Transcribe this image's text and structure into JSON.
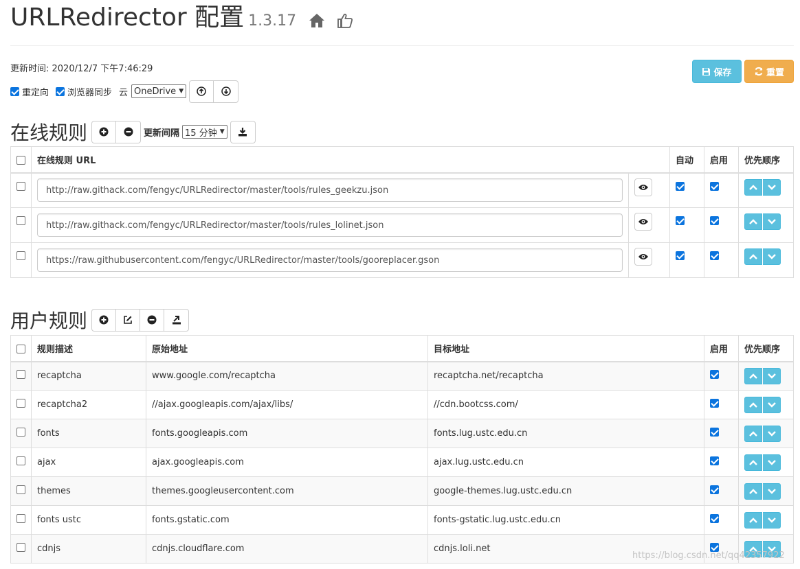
{
  "header": {
    "title": "URLRedirector 配置",
    "version": "1.3.17",
    "home_icon": "home-icon",
    "like_icon": "thumbs-up-icon"
  },
  "meta": {
    "updated_label": "更新时间: 2020/12/7 下午7:46:29"
  },
  "options": {
    "redirect": {
      "label": "重定向",
      "checked": true
    },
    "sync": {
      "label": "浏览器同步",
      "checked": true
    },
    "cloud_label": "云",
    "cloud_value": "OneDrive"
  },
  "actions": {
    "save_label": "保存",
    "reset_label": "重置"
  },
  "colors": {
    "info": "#5bc0de",
    "warning": "#f0ad4e",
    "check": "#0b74de"
  },
  "online": {
    "title": "在线规则",
    "interval_label": "更新间隔",
    "interval_value": "15 分钟",
    "columns": {
      "url": "在线规则 URL",
      "auto": "自动",
      "enabled": "启用",
      "priority": "优先顺序"
    },
    "rows": [
      {
        "url": "http://raw.githack.com/fengyc/URLRedirector/master/tools/rules_geekzu.json",
        "auto": true,
        "enabled": true
      },
      {
        "url": "http://raw.githack.com/fengyc/URLRedirector/master/tools/rules_lolinet.json",
        "auto": true,
        "enabled": true
      },
      {
        "url": "https://raw.githubusercontent.com/fengyc/URLRedirector/master/tools/gooreplacer.gson",
        "auto": true,
        "enabled": true
      }
    ]
  },
  "user": {
    "title": "用户规则",
    "columns": {
      "desc": "规则描述",
      "origin": "原始地址",
      "target": "目标地址",
      "enabled": "启用",
      "priority": "优先顺序"
    },
    "rows": [
      {
        "desc": "recaptcha",
        "origin": "www.google.com/recaptcha",
        "target": "recaptcha.net/recaptcha",
        "enabled": true
      },
      {
        "desc": "recaptcha2",
        "origin": "//ajax.googleapis.com/ajax/libs/",
        "target": "//cdn.bootcss.com/",
        "enabled": true
      },
      {
        "desc": "fonts",
        "origin": "fonts.googleapis.com",
        "target": "fonts.lug.ustc.edu.cn",
        "enabled": true
      },
      {
        "desc": "ajax",
        "origin": "ajax.googleapis.com",
        "target": "ajax.lug.ustc.edu.cn",
        "enabled": true
      },
      {
        "desc": "themes",
        "origin": "themes.googleusercontent.com",
        "target": "google-themes.lug.ustc.edu.cn",
        "enabled": true
      },
      {
        "desc": "fonts ustc",
        "origin": "fonts.gstatic.com",
        "target": "fonts-gstatic.lug.ustc.edu.cn",
        "enabled": true
      },
      {
        "desc": "cdnjs",
        "origin": "cdnjs.cloudflare.com",
        "target": "cdnjs.loli.net",
        "enabled": true
      }
    ]
  },
  "watermark": "https://blog.csdn.net/qq42357922"
}
